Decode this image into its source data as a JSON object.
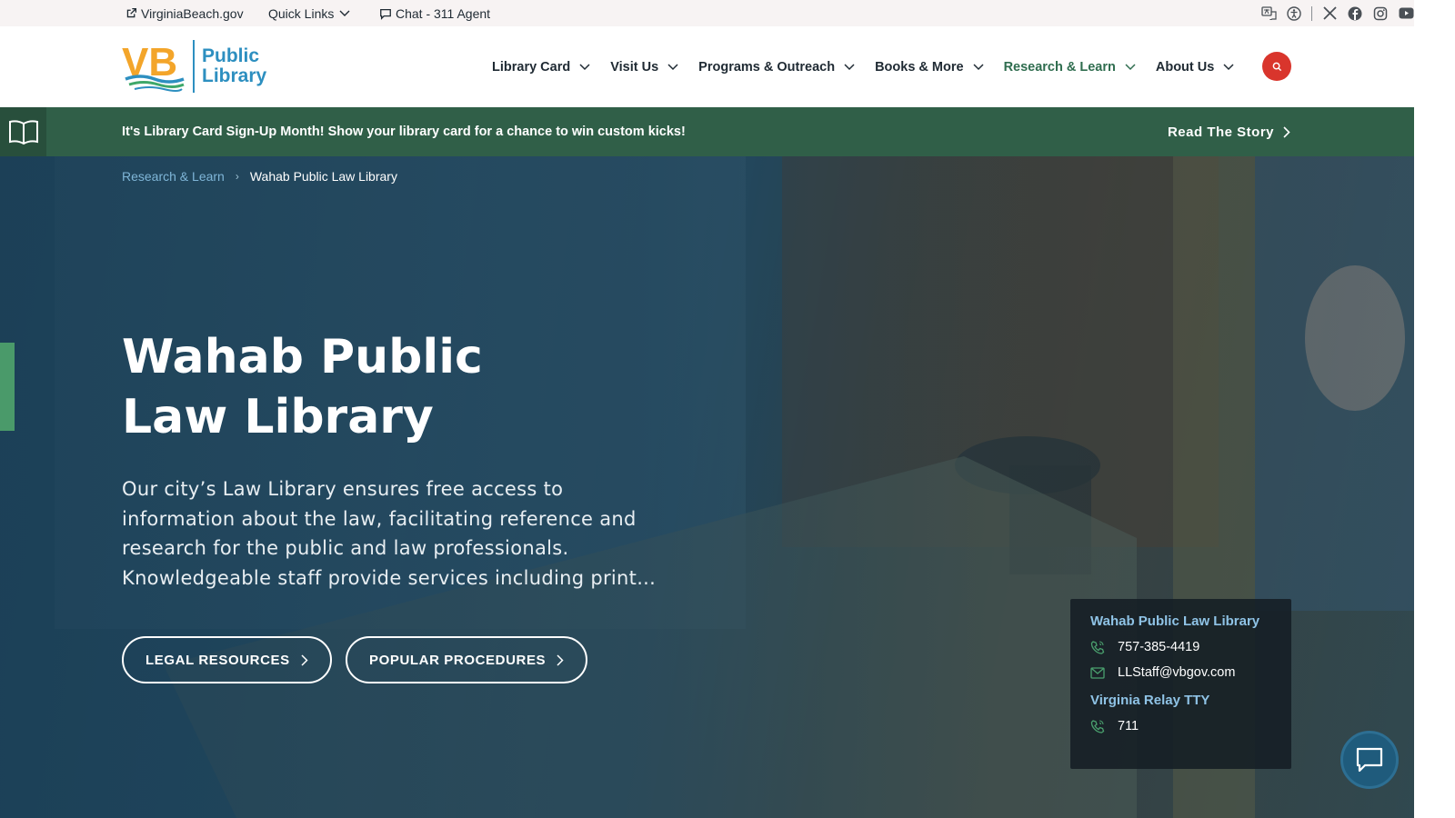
{
  "utility": {
    "site_link": "VirginiaBeach.gov",
    "quick_links": "Quick Links",
    "chat": "Chat - 311 Agent",
    "social_icons": [
      "translate-icon",
      "accessibility-icon",
      "x-icon",
      "facebook-icon",
      "instagram-icon",
      "youtube-icon"
    ]
  },
  "logo": {
    "mark": "VB",
    "line1": "Public",
    "line2": "Library"
  },
  "nav": {
    "items": [
      {
        "label": "Library Card"
      },
      {
        "label": "Visit Us"
      },
      {
        "label": "Programs & Outreach"
      },
      {
        "label": "Books & More"
      },
      {
        "label": "Research & Learn",
        "active": true
      },
      {
        "label": "About Us"
      }
    ]
  },
  "alert": {
    "text": "It's Library Card Sign-Up Month! Show your library card for a chance to win custom kicks!",
    "link": "Read The Story"
  },
  "breadcrumb": {
    "parent": "Research & Learn",
    "current": "Wahab Public Law Library"
  },
  "hero": {
    "title_line1": "Wahab Public",
    "title_line2": "Law Library",
    "description": "Our city’s Law Library ensures free access to information about the law, facilitating reference and research for the public and law professionals. Knowledgeable staff provide services including print...",
    "button1": "LEGAL RESOURCES",
    "button2": "POPULAR PROCEDURES"
  },
  "contact": {
    "title": "Wahab Public Law Library",
    "phone": "757-385-4419",
    "email": "LLStaff@vbgov.com",
    "tty_title": "Virginia Relay TTY",
    "tty_phone": "711"
  },
  "colors": {
    "accent_green": "#305f48",
    "brand_blue": "#2d8fc0",
    "search_red": "#d9352c",
    "active_nav": "#2f6d4f"
  }
}
